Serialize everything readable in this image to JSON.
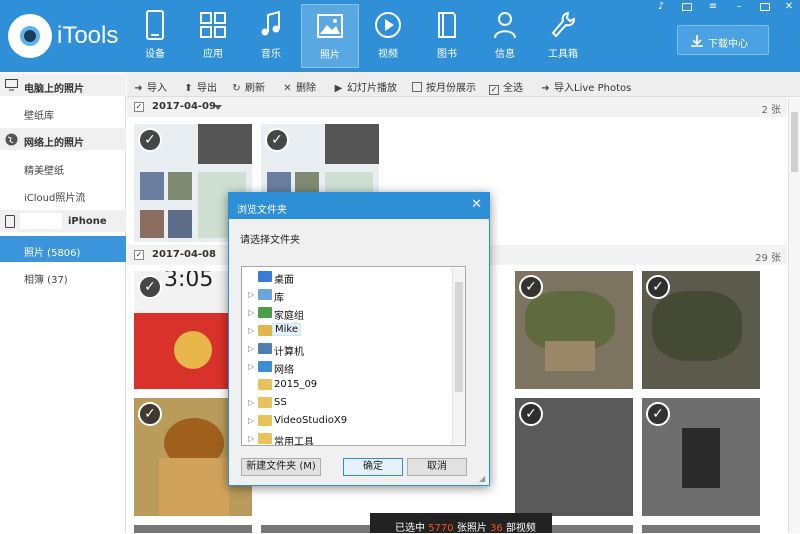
{
  "app": {
    "name": "iTools"
  },
  "nav": [
    {
      "label": "设备",
      "icon": "phone-icon"
    },
    {
      "label": "应用",
      "icon": "apps-icon"
    },
    {
      "label": "音乐",
      "icon": "music-icon"
    },
    {
      "label": "照片",
      "icon": "photo-icon",
      "active": true
    },
    {
      "label": "视频",
      "icon": "video-icon"
    },
    {
      "label": "图书",
      "icon": "book-icon"
    },
    {
      "label": "信息",
      "icon": "user-icon"
    },
    {
      "label": "工具箱",
      "icon": "wrench-icon"
    }
  ],
  "download_button": {
    "label": "下载中心"
  },
  "sidebar": {
    "pc_header": "电脑上的照片",
    "wallpaper_lib": "壁纸库",
    "web_header": "网络上的照片",
    "fine_wallpaper": "精美壁纸",
    "icloud": "iCloud照片流",
    "device_header": "iPhone",
    "photos": "照片 (5806)",
    "albums": "相簿 (37)"
  },
  "toolbar": {
    "import": "导入",
    "export": "导出",
    "refresh": "刷新",
    "delete": "删除",
    "slideshow": "幻灯片播放",
    "by_month": "按月份展示",
    "select_all": "全选",
    "import_live": "导入Live Photos"
  },
  "groups": [
    {
      "date": "2017-04-09",
      "count": "2 张"
    },
    {
      "date": "2017-04-08",
      "count": "29 张"
    }
  ],
  "photo_texts": {
    "time": "3:05"
  },
  "status": {
    "prefix": "已选中",
    "selected": "5770",
    "mid": "张照片",
    "count": "36",
    "suffix": "部视频"
  },
  "dialog": {
    "title": "浏览文件夹",
    "prompt": "请选择文件夹",
    "tree": [
      {
        "label": "桌面",
        "icon": "desktop-icon",
        "expandable": false
      },
      {
        "label": "库",
        "icon": "library-icon",
        "expandable": true
      },
      {
        "label": "家庭组",
        "icon": "homegroup-icon",
        "expandable": true
      },
      {
        "label": "Mike",
        "icon": "user-folder-icon",
        "expandable": true,
        "selected": true
      },
      {
        "label": "计算机",
        "icon": "computer-icon",
        "expandable": true
      },
      {
        "label": "网络",
        "icon": "network-icon",
        "expandable": true
      },
      {
        "label": "2015_09",
        "icon": "folder-icon",
        "expandable": false
      },
      {
        "label": "SS",
        "icon": "folder-icon",
        "expandable": true
      },
      {
        "label": "VideoStudioX9",
        "icon": "folder-icon",
        "expandable": true
      },
      {
        "label": "常用工具",
        "icon": "folder-icon",
        "expandable": true
      }
    ],
    "new_folder": "新建文件夹 (M)",
    "ok": "确定",
    "cancel": "取消"
  },
  "colors": {
    "accent": "#2f90d8",
    "status_highlight": "#f5521b"
  }
}
